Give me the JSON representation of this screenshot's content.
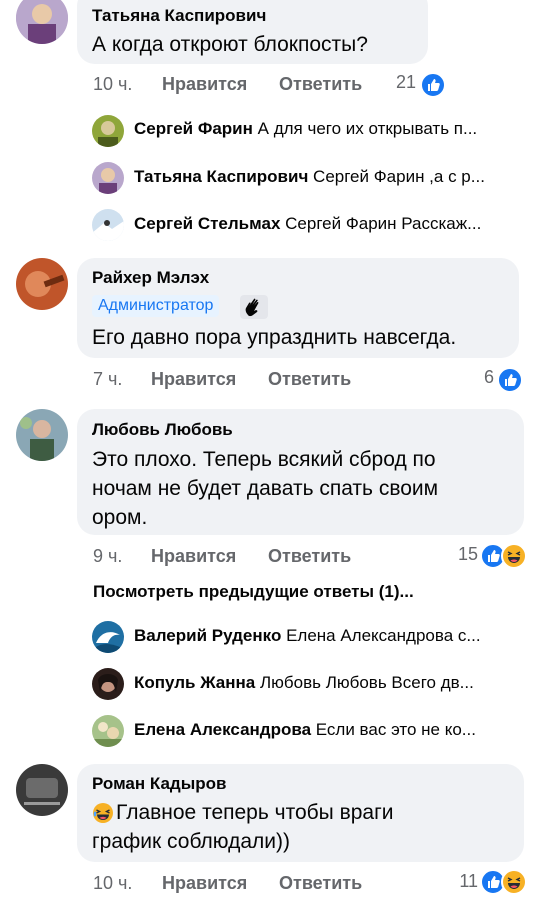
{
  "comments": [
    {
      "author": "Татьяна Каспирович",
      "text": "А когда откроют блокпосты?",
      "time": "10 ч.",
      "like_label": "Нравится",
      "reply_label": "Ответить",
      "reactions_count": "21",
      "reaction_icons": [
        "like-icon"
      ],
      "replies": [
        {
          "author": "Сергей Фарин",
          "text": "А для чего их открывать п..."
        },
        {
          "author": "Татьяна Каспирович",
          "text": "Сергей Фарин ,а с р..."
        },
        {
          "author": "Сергей Стельмах",
          "text": "Сергей Фарин Расскаж..."
        }
      ]
    },
    {
      "author": "Райхер Мэлэх",
      "badge": "Администратор",
      "badge_icon": "wave-icon",
      "text": "Его давно пора упразднить навсегда.",
      "time": "7 ч.",
      "like_label": "Нравится",
      "reply_label": "Ответить",
      "reactions_count": "6",
      "reaction_icons": [
        "like-icon"
      ]
    },
    {
      "author": "Любовь Любовь",
      "text_lines": [
        "Это плохо. Теперь всякий сброд по",
        "ночам не будет давать спать своим",
        "ором."
      ],
      "time": "9 ч.",
      "like_label": "Нравится",
      "reply_label": "Ответить",
      "reactions_count": "15",
      "reaction_icons": [
        "like-icon",
        "haha-icon"
      ],
      "previous_replies_label": "Посмотреть предыдущие ответы (1)...",
      "replies": [
        {
          "author": "Валерий Руденко",
          "text": "Елена Александрова с..."
        },
        {
          "author": "Копуль Жанна",
          "text": "Любовь Любовь Всего дв..."
        },
        {
          "author": "Елена Александрова",
          "text": "Если вас это не ко..."
        }
      ]
    },
    {
      "author": "Роман Кадыров",
      "text_lines": [
        "Главное теперь чтобы враги",
        "график соблюдали))"
      ],
      "text_emoji": "laughing-emoji",
      "time": "10 ч.",
      "like_label": "Нравится",
      "reply_label": "Ответить",
      "reactions_count": "11",
      "reaction_icons": [
        "like-icon",
        "haha-icon"
      ]
    }
  ],
  "colors": {
    "bubble": "#f0f2f5",
    "meta": "#65676b",
    "accent": "#1877f2",
    "haha": "#f7b125"
  }
}
